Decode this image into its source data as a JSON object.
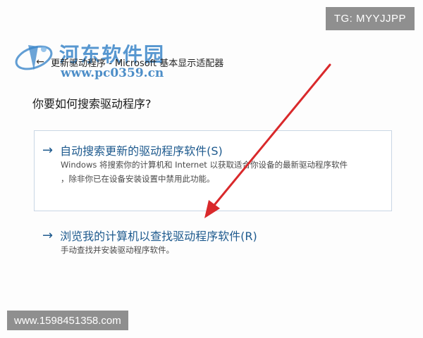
{
  "window": {
    "title": "更新驱动程序 - Microsoft 基本显示适配器"
  },
  "watermark": {
    "site_name": "河东软件园",
    "url": "www.pc0359.cn"
  },
  "question": "你要如何搜索驱动程序?",
  "options": [
    {
      "title": "自动搜索更新的驱动程序软件(S)",
      "desc_line1": "Windows 将搜索你的计算机和 Internet 以获取适合你设备的最新驱动程序软件",
      "desc_line2": "，除非你已在设备安装设置中禁用此功能。"
    },
    {
      "title": "浏览我的计算机以查找驱动程序软件(R)",
      "desc_line1": "手动查找并安装驱动程序软件。"
    }
  ],
  "overlay": {
    "tg_label": "TG: MYYJJPP",
    "phone_label": "www.1598451358.com"
  },
  "colors": {
    "link_blue": "#1e5a8e",
    "annotation_red": "#d9292b",
    "watermark_blue": "#3b86c9"
  }
}
